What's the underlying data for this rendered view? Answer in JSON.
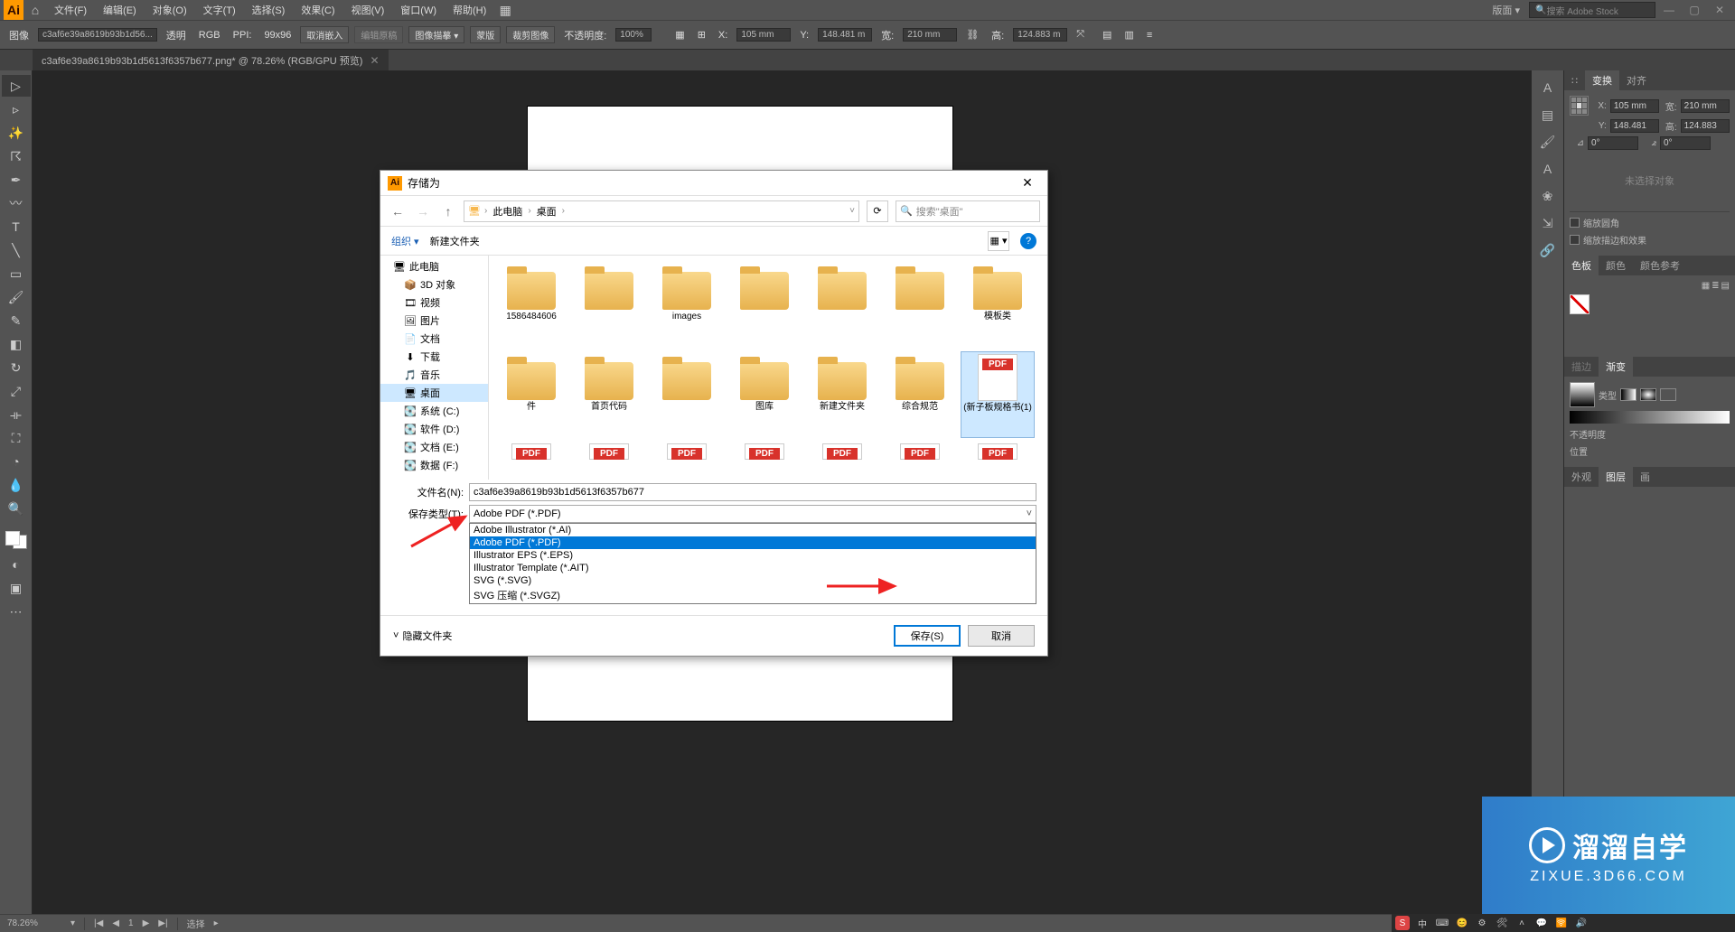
{
  "menubar": {
    "items": [
      "文件(F)",
      "编辑(E)",
      "对象(O)",
      "文字(T)",
      "选择(S)",
      "效果(C)",
      "视图(V)",
      "窗口(W)",
      "帮助(H)"
    ],
    "right_label": "版面",
    "search_placeholder": "搜索 Adobe Stock"
  },
  "optbar": {
    "label_image": "图像",
    "filename": "c3af6e39a8619b93b1d56...",
    "transparent": "透明",
    "colormode": "RGB",
    "ppi_label": "PPI:",
    "ppi": "99x96",
    "unembed": "取消嵌入",
    "edit_original": "编辑原稿",
    "image_trace": "图像描摹",
    "mask": "蒙版",
    "crop": "裁剪图像",
    "opacity_label": "不透明度:",
    "opacity": "100%",
    "x_label": "X:",
    "x": "105 mm",
    "y_label": "Y:",
    "y": "148.481 m",
    "w_label": "宽:",
    "w": "210 mm",
    "h_label": "高:",
    "h": "124.883 m"
  },
  "doctab": {
    "title": "c3af6e39a8619b93b1d5613f6357b677.png* @ 78.26% (RGB/GPU 预览)"
  },
  "transform": {
    "tab_transform": "变换",
    "tab_align": "对齐",
    "x_label": "X:",
    "x": "105 mm",
    "y_label": "Y:",
    "y": "148.481",
    "w_label": "宽:",
    "w": "210 mm",
    "h_label": "高:",
    "h": "124.883",
    "angle": "0°",
    "shear": "0°",
    "scale_corners": "缩放圆角",
    "scale_strokes": "缩放描边和效果",
    "placeholder": "未选择对象"
  },
  "swatches": {
    "tab_color_board": "色板",
    "tab_color": "颜色",
    "tab_color_ref": "颜色参考"
  },
  "stroke": {
    "tab_stroke": "描边",
    "tab_gradient": "渐变",
    "type_label": "类型",
    "opacity_label": "不透明度",
    "position_label": "位置"
  },
  "layers": {
    "tab_appearance": "外观",
    "tab_layers": "图层",
    "tab_art": "画"
  },
  "status": {
    "zoom": "78.26%",
    "nav": "1",
    "sel": "选择"
  },
  "dialog": {
    "title": "存储为",
    "crumbs": [
      "此电脑",
      "桌面"
    ],
    "search_placeholder": "搜索\"桌面\"",
    "organize": "组织",
    "new_folder": "新建文件夹",
    "tree": [
      {
        "label": "此电脑",
        "icon": "🖥",
        "indent": 0
      },
      {
        "label": "3D 对象",
        "icon": "📦",
        "indent": 1
      },
      {
        "label": "视频",
        "icon": "🎞",
        "indent": 1
      },
      {
        "label": "图片",
        "icon": "🖼",
        "indent": 1
      },
      {
        "label": "文档",
        "icon": "📄",
        "indent": 1
      },
      {
        "label": "下载",
        "icon": "⬇",
        "indent": 1
      },
      {
        "label": "音乐",
        "icon": "🎵",
        "indent": 1
      },
      {
        "label": "桌面",
        "icon": "🖥",
        "indent": 1,
        "selected": true
      },
      {
        "label": "系统 (C:)",
        "icon": "💽",
        "indent": 1
      },
      {
        "label": "软件 (D:)",
        "icon": "💽",
        "indent": 1
      },
      {
        "label": "文档 (E:)",
        "icon": "💽",
        "indent": 1
      },
      {
        "label": "数据 (F:)",
        "icon": "💽",
        "indent": 1
      }
    ],
    "files_row1": [
      {
        "label": "1586484606",
        "type": "folder"
      },
      {
        "label": "",
        "type": "folder"
      },
      {
        "label": "images",
        "type": "folder"
      },
      {
        "label": "",
        "type": "folder"
      },
      {
        "label": "",
        "type": "folder"
      },
      {
        "label": "",
        "type": "folder"
      },
      {
        "label": "模板类",
        "type": "folder"
      }
    ],
    "files_row2": [
      {
        "label": "件",
        "type": "folder"
      },
      {
        "label": "首页代码",
        "type": "folder"
      },
      {
        "label": "",
        "type": "folder"
      },
      {
        "label": "图库",
        "type": "folder"
      },
      {
        "label": "新建文件夹",
        "type": "folder"
      },
      {
        "label": "综合规范",
        "type": "folder"
      },
      {
        "label": "(新子板规格书(1)",
        "type": "pdf",
        "selected": true
      }
    ],
    "files_row3": [
      {
        "label": "",
        "type": "pdf"
      },
      {
        "label": "",
        "type": "pdf"
      },
      {
        "label": "",
        "type": "pdf"
      },
      {
        "label": "",
        "type": "pdf"
      },
      {
        "label": "",
        "type": "pdf"
      },
      {
        "label": "",
        "type": "pdf"
      },
      {
        "label": "",
        "type": "pdf"
      }
    ],
    "filename_label": "文件名(N):",
    "filename_value": "c3af6e39a8619b93b1d5613f6357b677",
    "filetype_label": "保存类型(T):",
    "filetype_value": "Adobe PDF (*.PDF)",
    "type_options": [
      {
        "label": "Adobe Illustrator (*.AI)"
      },
      {
        "label": "Adobe PDF (*.PDF)",
        "highlight": true
      },
      {
        "label": "Illustrator EPS (*.EPS)"
      },
      {
        "label": "Illustrator Template (*.AIT)"
      },
      {
        "label": "SVG (*.SVG)"
      },
      {
        "label": "SVG 压缩 (*.SVGZ)"
      }
    ],
    "hide_folders": "隐藏文件夹",
    "save_btn": "保存(S)",
    "cancel_btn": "取消"
  },
  "watermark": {
    "text": "溜溜自学",
    "sub": "ZIXUE.3D66.COM"
  }
}
